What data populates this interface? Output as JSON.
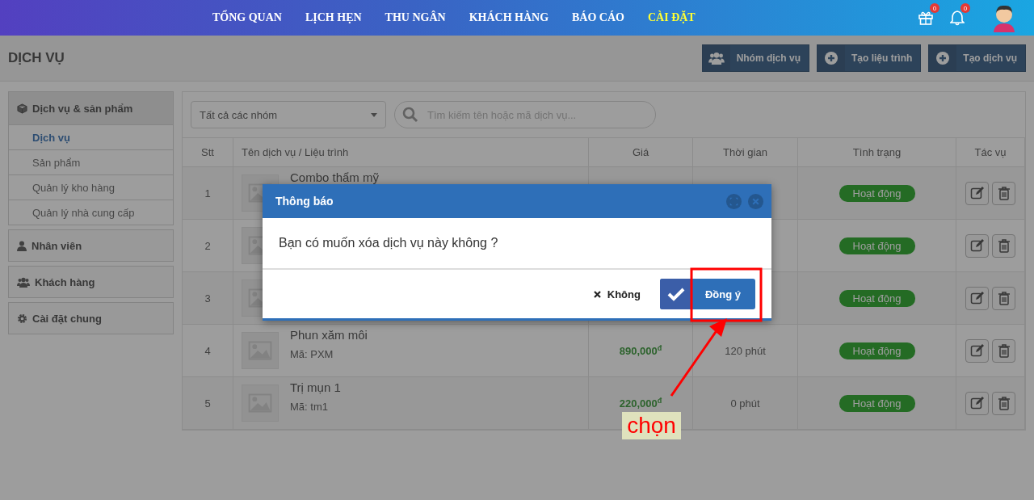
{
  "nav": {
    "items": [
      {
        "label": "TỔNG QUAN",
        "selected": false
      },
      {
        "label": "LỊCH HẸN",
        "selected": false
      },
      {
        "label": "THU NGÂN",
        "selected": false
      },
      {
        "label": "KHÁCH HÀNG",
        "selected": false
      },
      {
        "label": "BÁO CÁO",
        "selected": false
      },
      {
        "label": "CÀI ĐẶT",
        "selected": true
      }
    ],
    "gift_count": "0",
    "bell_count": "0"
  },
  "page": {
    "title": "DỊCH VỤ",
    "buttons": [
      {
        "label": "Nhóm dịch vụ",
        "kind": "group"
      },
      {
        "label": "Tạo liệu trình",
        "kind": "add"
      },
      {
        "label": "Tạo dịch vụ",
        "kind": "add"
      }
    ]
  },
  "sidebar": {
    "groups": [
      {
        "label": "Dịch vụ & sản phẩm",
        "kind": "box",
        "expanded": true,
        "children": [
          {
            "label": "Dịch vụ",
            "selected": true
          },
          {
            "label": "Sản phẩm",
            "selected": false
          },
          {
            "label": "Quản lý kho hàng",
            "selected": false
          },
          {
            "label": "Quản lý nhà cung cấp",
            "selected": false
          }
        ]
      },
      {
        "label": "Nhân viên",
        "kind": "user",
        "expanded": false
      },
      {
        "label": "Khách hàng",
        "kind": "users",
        "expanded": false
      },
      {
        "label": "Cài đặt chung",
        "kind": "gear",
        "expanded": false
      }
    ]
  },
  "filters": {
    "group_select": "Tất cả các nhóm",
    "search": {
      "placeholder": "Tìm kiếm tên hoặc mã dịch vụ..."
    }
  },
  "table": {
    "columns": [
      "Stt",
      "Tên dịch vụ / Liệu trình",
      "Giá",
      "Thời gian",
      "Tình trạng",
      "Tác vụ"
    ],
    "rows": [
      {
        "stt": "1",
        "name": "Combo thẩm mỹ",
        "status": "Hoạt động"
      },
      {
        "stt": "2",
        "status": "Hoạt động"
      },
      {
        "stt": "3",
        "status": "Hoạt động"
      },
      {
        "stt": "4",
        "name": "Phun xăm môi",
        "code": "Mã: PXM",
        "price": "890,000",
        "currency": "đ",
        "duration": "120 phút",
        "status": "Hoạt động"
      },
      {
        "stt": "5",
        "name": "Trị mụn 1",
        "code": "Mã: tm1",
        "price": "220,000",
        "currency": "đ",
        "duration": "0 phút",
        "status": "Hoạt động"
      }
    ]
  },
  "dialog": {
    "title": "Thông báo",
    "message": "Bạn có muốn xóa dịch vụ này không ?",
    "cancel": "Không",
    "confirm": "Đồng ý"
  },
  "annotation": {
    "label": "chọn"
  }
}
